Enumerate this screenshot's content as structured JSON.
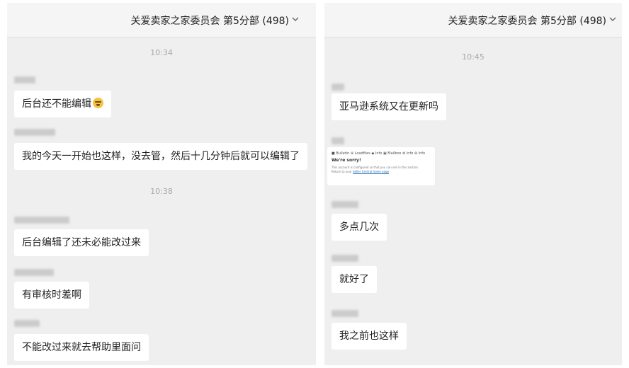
{
  "left": {
    "header": {
      "title": "关爱卖家之家委员会 第5分部 (498)"
    },
    "messages": [
      {
        "type": "time",
        "text": "10:34"
      },
      {
        "type": "msg",
        "text": "后台还不能编辑",
        "emoji": "grimacing-face-emoji"
      },
      {
        "type": "msg",
        "text": "我的今天一开始也这样，没去管，然后十几分钟后就可以编辑了"
      },
      {
        "type": "time",
        "text": "10:38"
      },
      {
        "type": "msg",
        "text": "后台编辑了还未必能改过来"
      },
      {
        "type": "msg",
        "text": "有审核时差啊"
      },
      {
        "type": "msg",
        "text": "不能改过来就去帮助里面问"
      }
    ]
  },
  "right": {
    "header": {
      "title": "关爱卖家之家委员会 第5分部 (498)"
    },
    "messages": [
      {
        "type": "time",
        "text": "10:45"
      },
      {
        "type": "msg",
        "text": "亚马逊系统又在更新吗"
      },
      {
        "type": "image",
        "screenshot": {
          "header_text": "■ Bulletin  ⊕ Loadfiles  ◆ Info  ▣ Mailbox  ⊗ Info  ⊕ Info",
          "title": "We're sorry!",
          "body_line1": "This account is configured so that you can sell in this section.",
          "body_line2": "Return to your",
          "link_text": "Seller Central home page"
        }
      },
      {
        "type": "msg",
        "text": "多点几次"
      },
      {
        "type": "msg",
        "text": "就好了"
      },
      {
        "type": "msg",
        "text": "我之前也这样"
      }
    ]
  },
  "colors": {
    "panel_bg": "#efeff0",
    "bubble_bg": "#ffffff",
    "time_color": "#a8a8a8"
  }
}
